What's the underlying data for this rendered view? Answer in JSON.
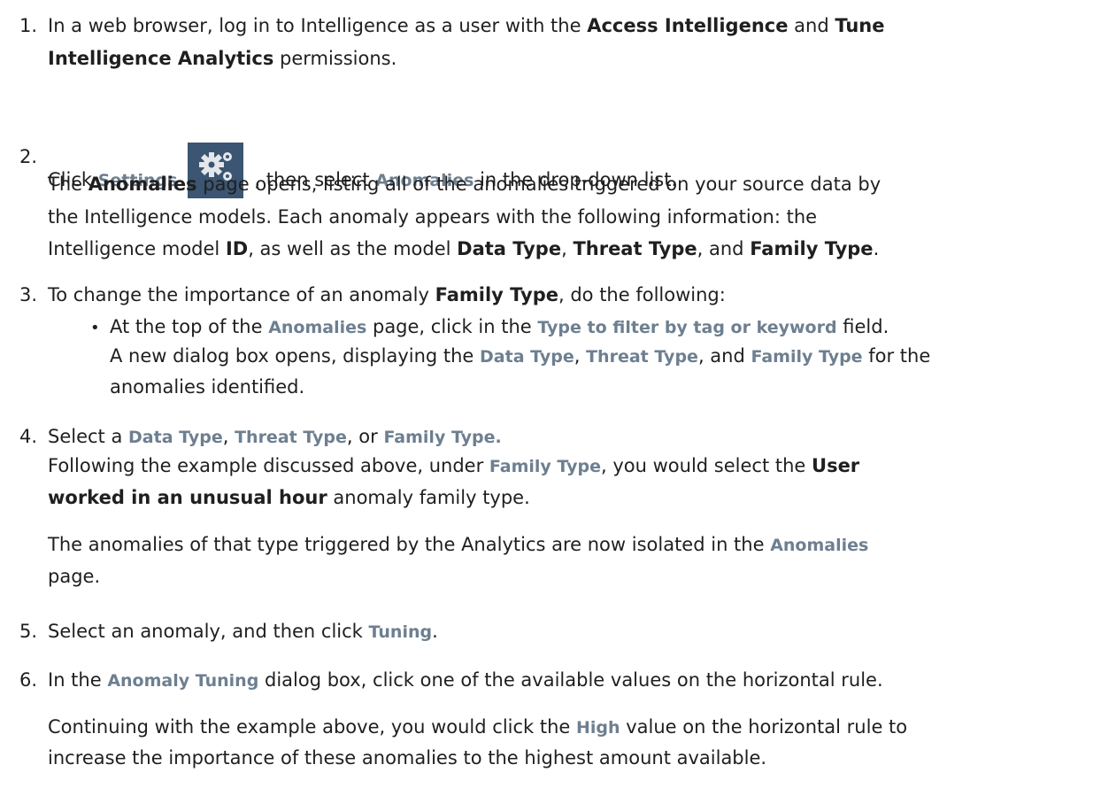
{
  "steps": [
    {
      "num": "1.",
      "l1a": "In a web browser, log in to Intelligence as a user with the ",
      "l1b": "Access Intelligence",
      "l1c": " and ",
      "l1d": "Tune",
      "l2a": "Intelligence Analytics",
      "l2b": " permissions."
    },
    {
      "num": "2.",
      "l1a": "Click ",
      "l1b": "Settings",
      "l1c": ", then select ",
      "l1d": "Anomalies",
      "l1e": " in the drop-down list.",
      "l2a": "The ",
      "l2b": "Anomalies",
      "l2c": " page opens, listing all of the anomalies triggered on your source data by",
      "l3": "the Intelligence models. Each anomaly appears with the following information: the",
      "l4a": "Intelligence model ",
      "l4b": "ID",
      "l4c": ", as well as the model ",
      "l4d": "Data Type",
      "l4e": ", ",
      "l4f": "Threat Type",
      "l4g": ", and ",
      "l4h": "Family Type",
      "l4i": ".",
      "icon": "settings-gears-icon"
    },
    {
      "num": "3.",
      "l1a": "To change the importance of an anomaly ",
      "l1b": "Family Type",
      "l1c": ", do the following:",
      "bullet": "•",
      "b1a": "At the top of the ",
      "b1b": "Anomalies",
      "b1c": " page, click in the ",
      "b1d": "Type to filter by tag or keyword",
      "b1e": " field.",
      "b2a": "A new dialog box opens, displaying the ",
      "b2b": "Data Type",
      "b2c": ", ",
      "b2d": "Threat Type",
      "b2e": ", and ",
      "b2f": "Family Type",
      "b2g": " for the",
      "b3": "anomalies identified."
    },
    {
      "num": "4.",
      "l1a": "Select a ",
      "l1b": "Data Type",
      "l1c": ", ",
      "l1d": "Threat Type",
      "l1e": ", or ",
      "l1f": "Family Type.",
      "l2a": "Following the example discussed above, under ",
      "l2b": "Family Type",
      "l2c": ", you would select the ",
      "l2d": "User",
      "l3a": "worked in an unusual hour",
      "l3b": " anomaly family type.",
      "l4a": "The anomalies of that type triggered by the Analytics are now isolated in the ",
      "l4b": "Anomalies",
      "l5": "page."
    },
    {
      "num": "5.",
      "l1a": "Select an anomaly, and then click ",
      "l1b": "Tuning",
      "l1c": "."
    },
    {
      "num": "6.",
      "l1a": "In the ",
      "l1b": "Anomaly Tuning",
      "l1c": " dialog box, click one of the available values on the horizontal rule.",
      "l2a": "Continuing with the example above, you would click the ",
      "l2b": "High",
      "l2c": " value on the horizontal rule to",
      "l3": "increase the importance of these anomalies to the highest amount available."
    }
  ]
}
